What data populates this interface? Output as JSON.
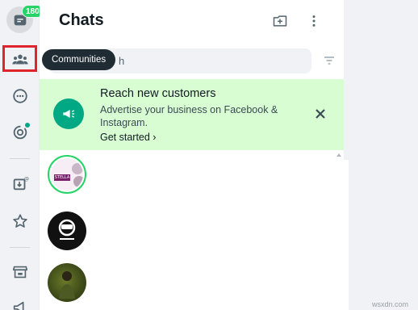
{
  "rail": {
    "unread_badge": "180",
    "tooltip": "Communities",
    "items": [
      {
        "name": "chats-icon"
      },
      {
        "name": "communities-icon"
      },
      {
        "name": "status-icon"
      },
      {
        "name": "channels-icon"
      },
      {
        "name": "archived-icon"
      },
      {
        "name": "starred-icon"
      },
      {
        "name": "business-tools-icon"
      },
      {
        "name": "megaphone-icon"
      }
    ]
  },
  "header": {
    "title": "Chats",
    "new_chat_icon": "new-chat-icon",
    "menu_icon": "menu-icon"
  },
  "search": {
    "visible_text": "h"
  },
  "banner": {
    "title": "Reach new customers",
    "text": "Advertise your business on Facebook & Instagram.",
    "link": "Get started ›"
  },
  "chat_list": [
    {
      "avatar_text": "STELLA"
    },
    {
      "avatar_text": ""
    },
    {
      "avatar_text": ""
    }
  ],
  "watermark": "wsxdn.com",
  "colors": {
    "accent": "#00a884",
    "badge": "#25d366",
    "banner_bg": "#d9fdd3",
    "highlight": "#e0242c",
    "tooltip_bg": "#1f2c34"
  }
}
